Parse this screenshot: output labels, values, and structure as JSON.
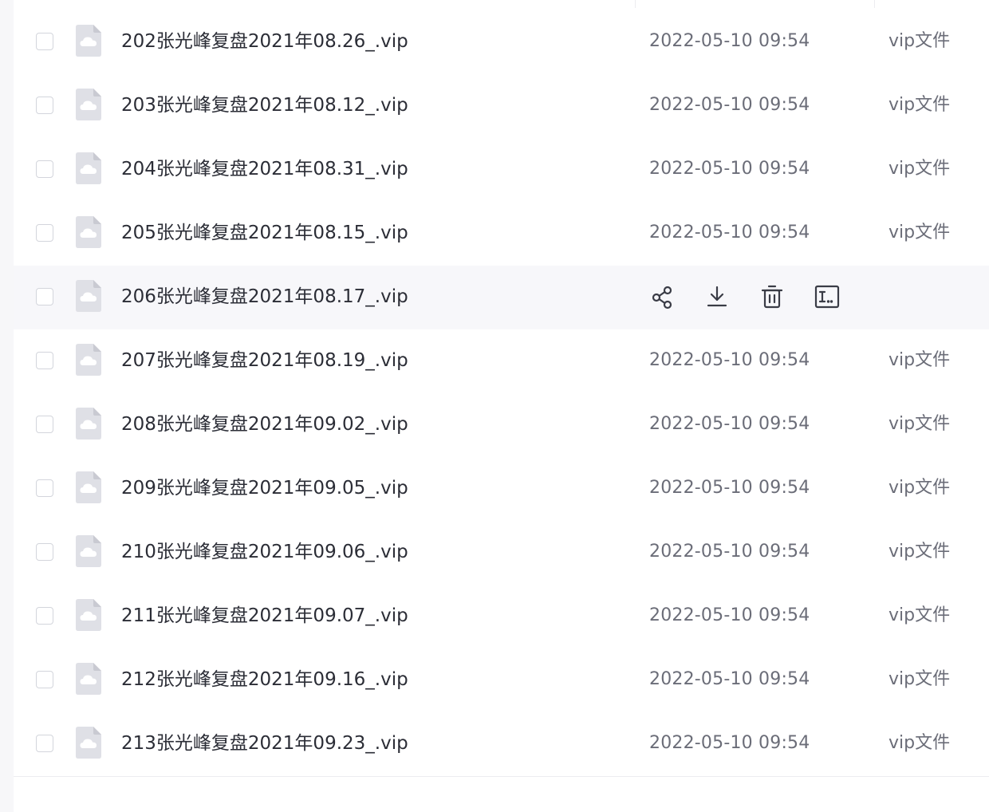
{
  "files": [
    {
      "name": "202张光峰复盘2021年08.26_.vip",
      "time": "2022-05-10 09:54",
      "type": "vip文件"
    },
    {
      "name": "203张光峰复盘2021年08.12_.vip",
      "time": "2022-05-10 09:54",
      "type": "vip文件"
    },
    {
      "name": "204张光峰复盘2021年08.31_.vip",
      "time": "2022-05-10 09:54",
      "type": "vip文件"
    },
    {
      "name": "205张光峰复盘2021年08.15_.vip",
      "time": "2022-05-10 09:54",
      "type": "vip文件"
    },
    {
      "name": "206张光峰复盘2021年08.17_.vip",
      "time": "",
      "type": "",
      "hovered": true
    },
    {
      "name": "207张光峰复盘2021年08.19_.vip",
      "time": "2022-05-10 09:54",
      "type": "vip文件"
    },
    {
      "name": "208张光峰复盘2021年09.02_.vip",
      "time": "2022-05-10 09:54",
      "type": "vip文件"
    },
    {
      "name": "209张光峰复盘2021年09.05_.vip",
      "time": "2022-05-10 09:54",
      "type": "vip文件"
    },
    {
      "name": "210张光峰复盘2021年09.06_.vip",
      "time": "2022-05-10 09:54",
      "type": "vip文件"
    },
    {
      "name": "211张光峰复盘2021年09.07_.vip",
      "time": "2022-05-10 09:54",
      "type": "vip文件"
    },
    {
      "name": "212张光峰复盘2021年09.16_.vip",
      "time": "2022-05-10 09:54",
      "type": "vip文件"
    },
    {
      "name": "213张光峰复盘2021年09.23_.vip",
      "time": "2022-05-10 09:54",
      "type": "vip文件"
    }
  ],
  "row_actions": [
    {
      "icon": "share-icon"
    },
    {
      "icon": "download-icon"
    },
    {
      "icon": "delete-icon"
    },
    {
      "icon": "rename-icon"
    }
  ],
  "colors": {
    "text_primary": "#2b2d36",
    "text_secondary": "#6b6d78",
    "hover_row": "#f7f7fa",
    "icon_grey": "#dfe0e6",
    "action_icon": "#3a3c46"
  }
}
